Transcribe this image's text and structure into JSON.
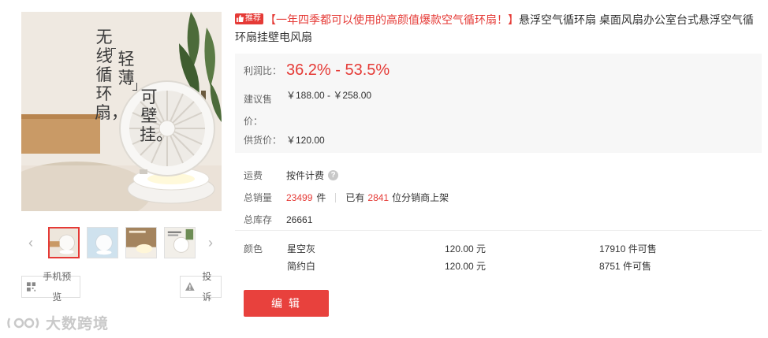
{
  "product": {
    "image_text": {
      "line1": "无线循环扇，",
      "line2": "轻薄",
      "line3": "可壁挂。"
    },
    "thumbnails": [
      {
        "name": "thumb-1",
        "selected": true
      },
      {
        "name": "thumb-2",
        "selected": false
      },
      {
        "name": "thumb-3",
        "selected": false
      },
      {
        "name": "thumb-4",
        "selected": false
      }
    ],
    "buttons": {
      "preview": "手机预览",
      "report": "投诉",
      "edit": "编 辑"
    },
    "watermark": "大数跨境",
    "badge": "推荐",
    "title_highlight": "【一年四季都可以使用的高颜值爆款空气循环扇！】",
    "title_rest": "悬浮空气循环扇 桌面风扇办公室台式悬浮空气循环扇挂壁电风扇"
  },
  "pricing": {
    "profit_label": "利润比：",
    "profit_value": "36.2% - 53.5%",
    "suggest_label": "建议售价：",
    "suggest_value": "￥188.00 - ￥258.00",
    "supply_label": "供货价：",
    "supply_value": "￥120.00"
  },
  "details": {
    "shipping_label": "运费",
    "shipping_value": "按件计费",
    "sales_label": "总销量",
    "sales_count": "23499",
    "sales_unit": "件",
    "listed_prefix": "已有",
    "listed_count": "2841",
    "listed_suffix": "位分销商上架",
    "stock_label": "总库存",
    "stock_value": "26661",
    "color_label": "颜色",
    "colors": [
      {
        "name": "星空灰",
        "price": "120.00 元",
        "stock": "17910 件可售"
      },
      {
        "name": "简约白",
        "price": "120.00 元",
        "stock": "8751 件可售"
      }
    ]
  },
  "theme": {
    "accent": "#e53a36",
    "price_box_bg": "#f7f7f7"
  }
}
